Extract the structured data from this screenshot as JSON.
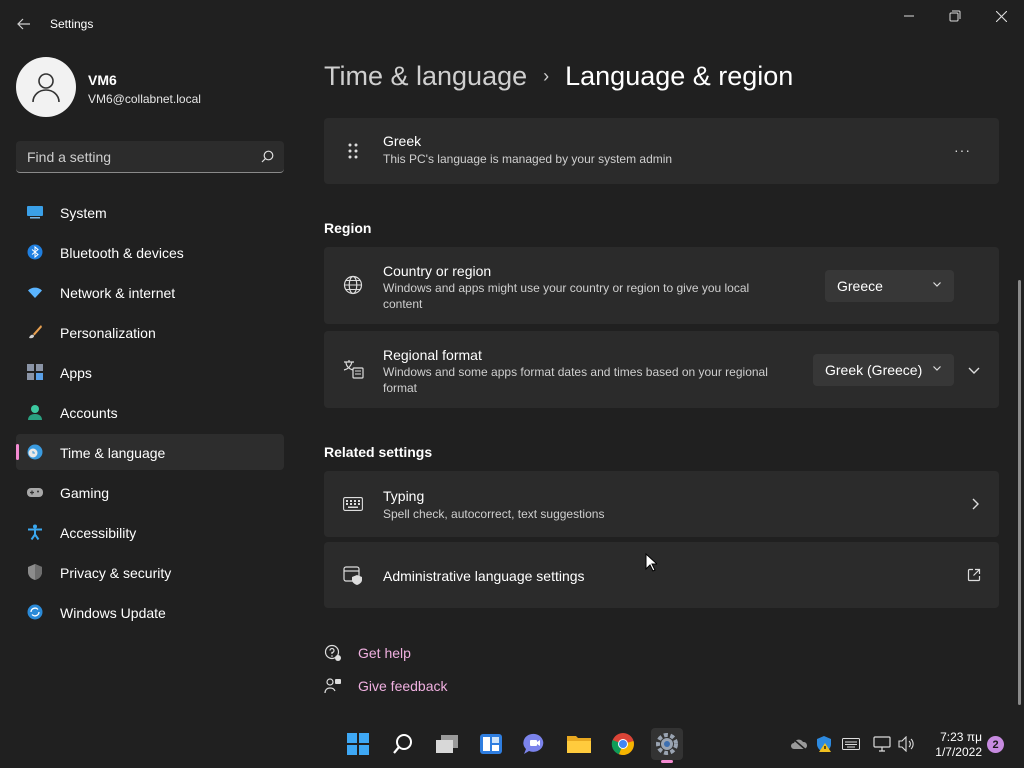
{
  "window": {
    "title": "Settings",
    "controls": {
      "back": "back-arrow-icon",
      "minimize": "minimize-icon",
      "maximize": "maximize-icon",
      "close": "close-icon"
    }
  },
  "profile": {
    "name": "VM6",
    "email": "VM6@collabnet.local"
  },
  "search": {
    "placeholder": "Find a setting"
  },
  "sidebar": {
    "items": [
      {
        "label": "System",
        "icon": "system-icon",
        "active": false
      },
      {
        "label": "Bluetooth & devices",
        "icon": "bluetooth-icon",
        "active": false
      },
      {
        "label": "Network & internet",
        "icon": "wifi-icon",
        "active": false
      },
      {
        "label": "Personalization",
        "icon": "brush-icon",
        "active": false
      },
      {
        "label": "Apps",
        "icon": "apps-icon",
        "active": false
      },
      {
        "label": "Accounts",
        "icon": "accounts-icon",
        "active": false
      },
      {
        "label": "Time & language",
        "icon": "time-language-icon",
        "active": true
      },
      {
        "label": "Gaming",
        "icon": "gamepad-icon",
        "active": false
      },
      {
        "label": "Accessibility",
        "icon": "accessibility-icon",
        "active": false
      },
      {
        "label": "Privacy & security",
        "icon": "shield-icon",
        "active": false
      },
      {
        "label": "Windows Update",
        "icon": "windows-update-icon",
        "active": false
      }
    ]
  },
  "breadcrumb": {
    "parent": "Time & language",
    "separator": "›",
    "current": "Language & region"
  },
  "language_card": {
    "title": "Greek",
    "description": "This PC's language is managed by your system admin",
    "more": "···"
  },
  "region": {
    "heading": "Region",
    "country": {
      "title": "Country or region",
      "description_line1": "Windows and apps might use your country or region to give you local",
      "description_line2": "content",
      "value": "Greece"
    },
    "format": {
      "title": "Regional format",
      "description_line1": "Windows and some apps format dates and times based on your regional",
      "description_line2": "format",
      "value": "Greek (Greece)"
    }
  },
  "related": {
    "heading": "Related settings",
    "typing": {
      "title": "Typing",
      "description": "Spell check, autocorrect, text suggestions"
    },
    "admin": {
      "title": "Administrative language settings"
    }
  },
  "links": {
    "help": "Get help",
    "feedback": "Give feedback"
  },
  "taskbar": {
    "apps": [
      "start-icon",
      "search-icon",
      "task-view-icon",
      "widgets-icon",
      "chat-icon",
      "file-explorer-icon",
      "chrome-icon",
      "settings-icon"
    ],
    "tray": [
      "onedrive-icon",
      "defender-icon",
      "keyboard-icon",
      "network-icon",
      "volume-icon"
    ],
    "time": "7:23 πμ",
    "date": "1/7/2022",
    "notifications": "2"
  },
  "colors": {
    "accent": "#f48bd2",
    "link": "#f0b0e0",
    "background": "#202020",
    "card": "#2b2b2b"
  }
}
